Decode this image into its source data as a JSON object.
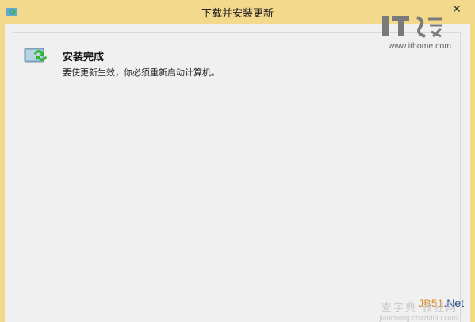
{
  "window": {
    "title": "下载并安装更新",
    "close_label": "✕"
  },
  "status": {
    "heading": "安装完成",
    "message": "要使更新生效，你必须重新启动计算机。"
  },
  "watermark": {
    "logo_text": "IT之家",
    "url": "www.ithome.com",
    "jb51_prefix": "JB51",
    "jb51_suffix": ".Net",
    "chazidian_text": "查字典 教程网",
    "chazidian_url": "jiaocheng.chazidian.com"
  },
  "colors": {
    "titlebar": "#f3d98b",
    "content_bg": "#f0f0f0",
    "update_green": "#2db52d"
  },
  "icons": {
    "title": "windows-update-icon",
    "status": "update-monitor-icon"
  }
}
